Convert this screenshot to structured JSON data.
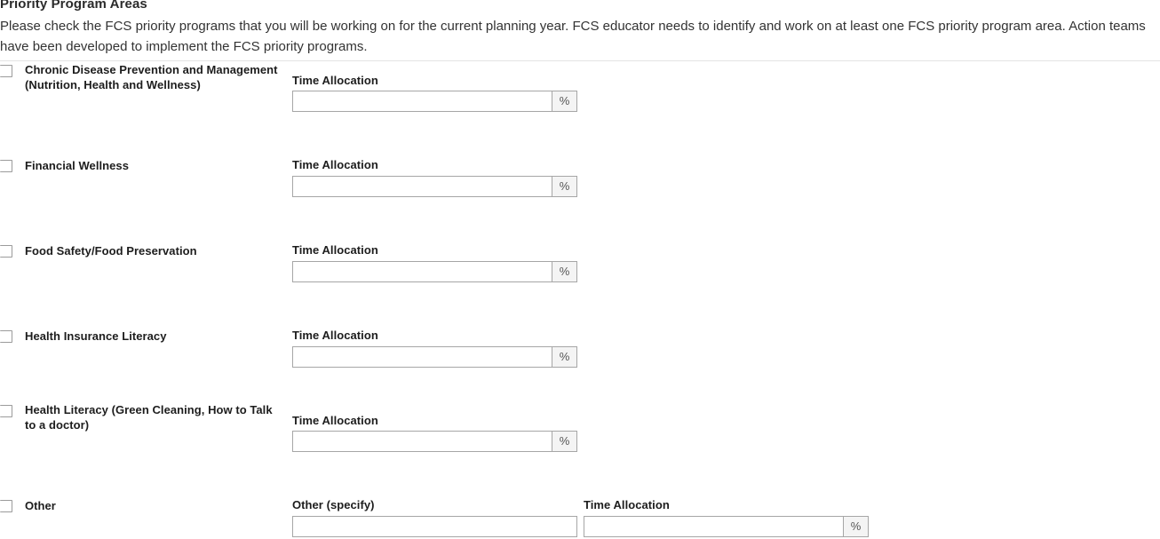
{
  "section": {
    "title": "Priority Program Areas",
    "description": "Please check the FCS priority programs that you will be working on for the current planning year. FCS educator needs to identify and work on at least one FCS priority program area. Action teams have been developed to implement the FCS priority programs."
  },
  "labels": {
    "time_allocation": "Time Allocation",
    "other_specify": "Other (specify)",
    "percent_addon": "%"
  },
  "options": [
    {
      "id": "chronic-disease-prevention-and-management",
      "label": "Chronic Disease Prevention and Management (Nutrition, Health and Wellness)",
      "checked": false,
      "time_allocation_value": "",
      "time_allocation_label": "Time Allocation"
    },
    {
      "id": "financial-wellness",
      "label": "Financial Wellness",
      "checked": false,
      "time_allocation_value": "",
      "time_allocation_label": "Time Allocation"
    },
    {
      "id": "food-safety-food-preservation",
      "label": "Food Safety/Food Preservation",
      "checked": false,
      "time_allocation_value": "",
      "time_allocation_label": "Time Allocation"
    },
    {
      "id": "health-insurance-literacy",
      "label": "Health Insurance Literacy",
      "checked": false,
      "time_allocation_value": "",
      "time_allocation_label": "Time Allocation"
    },
    {
      "id": "health-literacy",
      "label": "Health Literacy (Green Cleaning, How to Talk to a doctor)",
      "checked": false,
      "time_allocation_value": "",
      "time_allocation_label": "Time Allocation"
    },
    {
      "id": "other",
      "label": "Other",
      "checked": false,
      "other_specify_label": "Other (specify)",
      "other_specify_value": "",
      "time_allocation_value": "",
      "time_allocation_label": "Time Allocation"
    }
  ],
  "colors": {
    "text": "#222222",
    "label": "#1d1d1d",
    "border": "#a6a6a6",
    "divider": "#e3e3e3",
    "addon_background": "#f4f4f4"
  }
}
